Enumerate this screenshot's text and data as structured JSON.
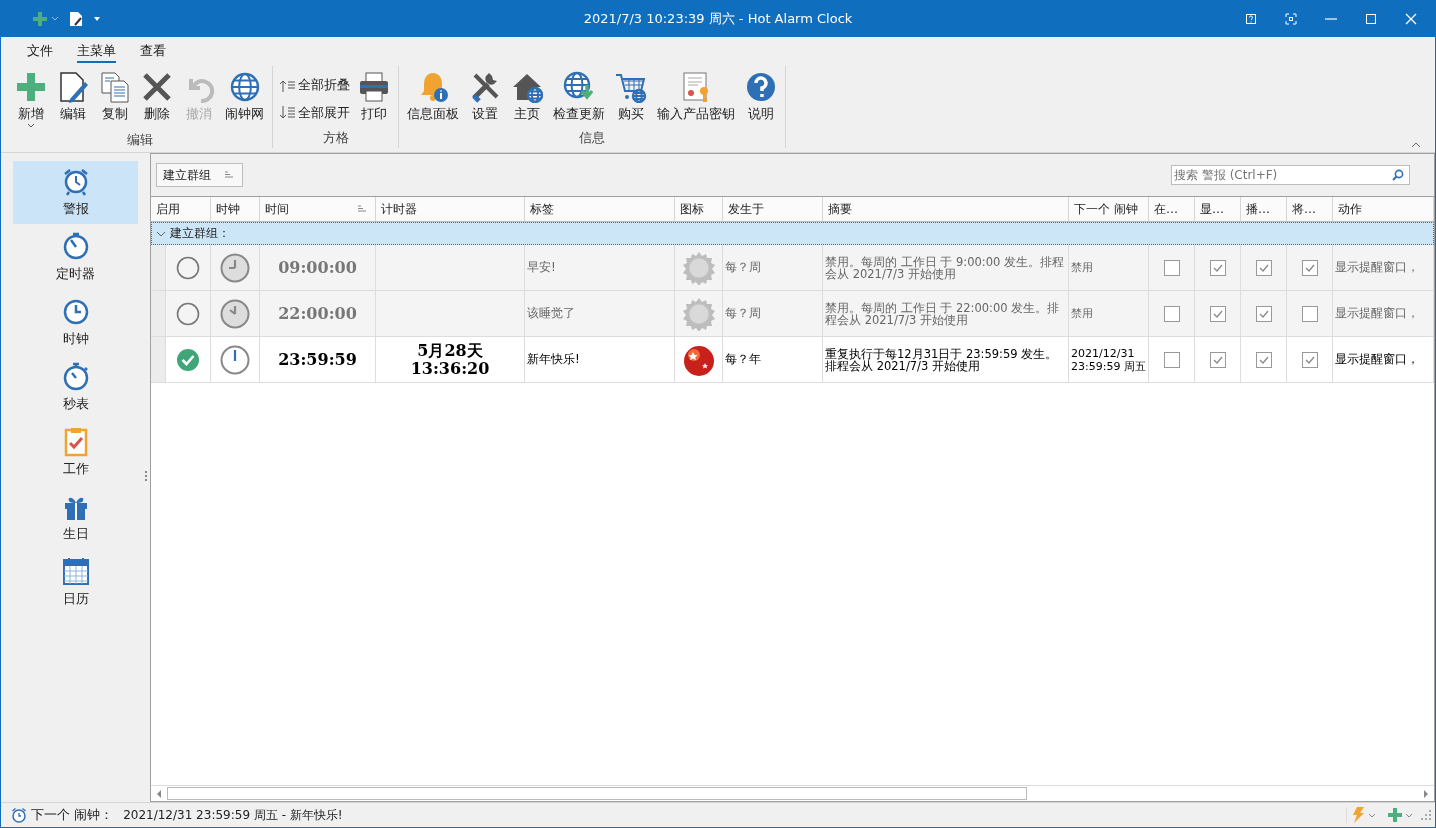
{
  "window": {
    "title": "2021/7/3 10:23:39 周六 - Hot Alarm Clock"
  },
  "menu_tabs": [
    {
      "label": "文件",
      "selected": false
    },
    {
      "label": "主菜单",
      "selected": true
    },
    {
      "label": "查看",
      "selected": false
    }
  ],
  "ribbon_groups": [
    {
      "label": "编辑",
      "buttons": [
        {
          "label": "新增",
          "kind": "large",
          "dropdown": true,
          "disabled": false
        },
        {
          "label": "编辑",
          "kind": "large",
          "dropdown": false,
          "disabled": false
        },
        {
          "label": "复制",
          "kind": "large",
          "dropdown": false,
          "disabled": false
        },
        {
          "label": "删除",
          "kind": "large",
          "dropdown": false,
          "disabled": false
        },
        {
          "label": "撤消",
          "kind": "large",
          "dropdown": false,
          "disabled": true
        },
        {
          "label": "闹钟网",
          "kind": "large",
          "dropdown": false,
          "disabled": false
        }
      ]
    },
    {
      "label": "方格",
      "buttons": [
        {
          "label": "全部折叠",
          "kind": "small",
          "dropdown": false,
          "disabled": false
        },
        {
          "label": "全部展开",
          "kind": "small",
          "dropdown": false,
          "disabled": false
        },
        {
          "label": "打印",
          "kind": "large",
          "dropdown": false,
          "disabled": false
        }
      ]
    },
    {
      "label": "信息",
      "buttons": [
        {
          "label": "信息面板",
          "kind": "large",
          "dropdown": false,
          "disabled": false
        },
        {
          "label": "设置",
          "kind": "large",
          "dropdown": false,
          "disabled": false
        },
        {
          "label": "主页",
          "kind": "large",
          "dropdown": false,
          "disabled": false
        },
        {
          "label": "检查更新",
          "kind": "large",
          "dropdown": false,
          "disabled": false
        },
        {
          "label": "购买",
          "kind": "large",
          "dropdown": false,
          "disabled": false
        },
        {
          "label": "输入产品密钥",
          "kind": "large",
          "dropdown": false,
          "disabled": false
        },
        {
          "label": "说明",
          "kind": "large",
          "dropdown": false,
          "disabled": false
        }
      ]
    }
  ],
  "sidebar": {
    "items": [
      {
        "label": "警报",
        "selected": true
      },
      {
        "label": "定时器",
        "selected": false
      },
      {
        "label": "时钟",
        "selected": false
      },
      {
        "label": "秒表",
        "selected": false
      },
      {
        "label": "工作",
        "selected": false
      },
      {
        "label": "生日",
        "selected": false
      },
      {
        "label": "日历",
        "selected": false
      }
    ]
  },
  "toolbar": {
    "group_button": "建立群组",
    "search": {
      "placeholder": "搜索 警报 (Ctrl+F)"
    }
  },
  "table": {
    "columns": [
      "启用",
      "时钟",
      "时间",
      "计时器",
      "标签",
      "图标",
      "发生于",
      "摘要",
      "下一个 闹钟",
      "在…",
      "显…",
      "播…",
      "将…",
      "动作"
    ],
    "group": {
      "label": "建立群组：",
      "expanded": true
    },
    "rows": [
      {
        "enabled": false,
        "time": "09:00:00",
        "label": "早安!",
        "occurs": "每？周",
        "summary": "禁用。每周的 工作日 于 9:00:00 发生。排程会从 2021/7/3 开始使用",
        "next": "禁用",
        "flags": [
          false,
          true,
          true,
          true
        ],
        "action": "显示提醒窗口，"
      },
      {
        "enabled": false,
        "time": "22:00:00",
        "label": "该睡觉了",
        "occurs": "每？周",
        "summary": "禁用。每周的 工作日 于 22:00:00 发生。排程会从 2021/7/3 开始使用",
        "next": "禁用",
        "flags": [
          false,
          true,
          true,
          false
        ],
        "action": "显示提醒窗口，"
      },
      {
        "enabled": true,
        "time": "23:59:59",
        "timer": "5月28天\n13:36:20",
        "label": "新年快乐!",
        "occurs": "每？年",
        "summary": "重复执行于每12月31日于 23:59:59 发生。排程会从 2021/7/3 开始使用",
        "next": "2021/12/31\n23:59:59 周五",
        "flags": [
          false,
          true,
          true,
          true
        ],
        "action": "显示提醒窗口，"
      }
    ]
  },
  "status_bar": {
    "label": "下一个 闹钟：",
    "value": "2021/12/31 23:59:59 周五 - 新年快乐!"
  }
}
